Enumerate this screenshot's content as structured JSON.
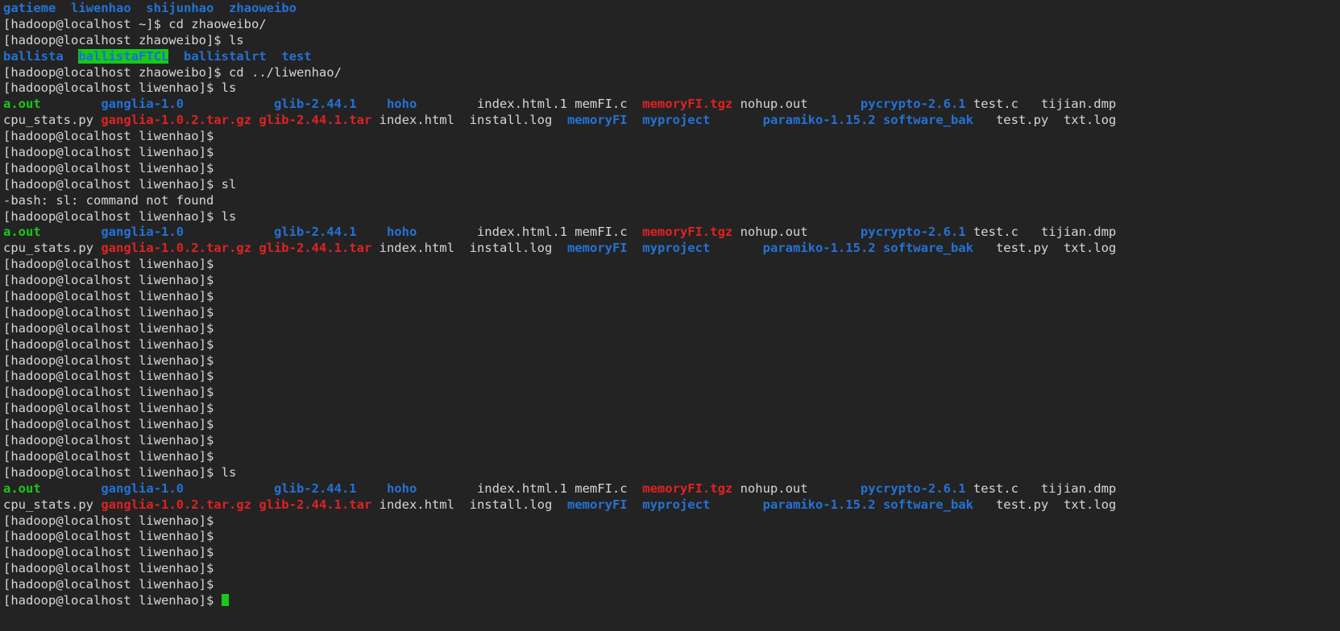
{
  "terminal": {
    "title": "Terminal",
    "background_color": "#232323",
    "foreground_color": "#d6d6d6",
    "dir_color": "#2472d4",
    "exec_color": "#19c819",
    "archive_color": "#e02222",
    "highlight_bg_color": "#19c819",
    "cursor_color": "#19c819",
    "prompt_home": "[hadoop@localhost ~]$ ",
    "prompt_zhaoweibo": "[hadoop@localhost zhaoweibo]$ ",
    "prompt_liwenhao": "[hadoop@localhost liwenhao]$ ",
    "commands": {
      "cd_zhaoweibo": "cd zhaoweibo/",
      "ls": "ls",
      "cd_liwenhao": "cd ../liwenhao/",
      "sl": "sl"
    },
    "errors": {
      "sl_not_found": "-bash: sl: command not found"
    }
  },
  "lines": [
    {
      "name": "home-dir-listing",
      "segments": [
        {
          "text": "gatieme",
          "style": "dir"
        },
        {
          "text": "  ",
          "style": "default"
        },
        {
          "text": "liwenhao",
          "style": "dir"
        },
        {
          "text": "  ",
          "style": "default"
        },
        {
          "text": "shijunhao",
          "style": "dir"
        },
        {
          "text": "  ",
          "style": "default"
        },
        {
          "text": "zhaoweibo",
          "style": "dir"
        }
      ]
    },
    {
      "name": "prompt-cd-zhaoweibo",
      "segments": [
        {
          "text": "[hadoop@localhost ~]$ cd zhaoweibo/",
          "style": "default"
        }
      ]
    },
    {
      "name": "prompt-ls-zhaoweibo",
      "segments": [
        {
          "text": "[hadoop@localhost zhaoweibo]$ ls",
          "style": "default"
        }
      ]
    },
    {
      "name": "zhaoweibo-listing",
      "segments": [
        {
          "text": "ballista",
          "style": "dir"
        },
        {
          "text": "  ",
          "style": "default"
        },
        {
          "text": "ballistaFTCL",
          "style": "hl-dir"
        },
        {
          "text": "  ",
          "style": "default"
        },
        {
          "text": "ballistalrt",
          "style": "dir"
        },
        {
          "text": "  ",
          "style": "default"
        },
        {
          "text": "test",
          "style": "dir"
        }
      ]
    },
    {
      "name": "prompt-cd-liwenhao",
      "segments": [
        {
          "text": "[hadoop@localhost zhaoweibo]$ cd ../liwenhao/",
          "style": "default"
        }
      ]
    },
    {
      "name": "prompt-ls-liwenhao-1",
      "segments": [
        {
          "text": "[hadoop@localhost liwenhao]$ ls",
          "style": "default"
        }
      ]
    },
    {
      "name": "liwenhao-listing-row1-a",
      "segments": [
        {
          "text": "a.out",
          "style": "exec"
        },
        {
          "text": "        ",
          "style": "default"
        },
        {
          "text": "ganglia-1.0",
          "style": "dir"
        },
        {
          "text": "            ",
          "style": "default"
        },
        {
          "text": "glib-2.44.1",
          "style": "dir"
        },
        {
          "text": "    ",
          "style": "default"
        },
        {
          "text": "hoho",
          "style": "dir"
        },
        {
          "text": "        ",
          "style": "default"
        },
        {
          "text": "index.html.1",
          "style": "default"
        },
        {
          "text": " ",
          "style": "default"
        },
        {
          "text": "memFI.c",
          "style": "default"
        },
        {
          "text": "  ",
          "style": "default"
        },
        {
          "text": "memoryFI.tgz",
          "style": "arch"
        },
        {
          "text": " ",
          "style": "default"
        },
        {
          "text": "nohup.out",
          "style": "default"
        },
        {
          "text": "       ",
          "style": "default"
        },
        {
          "text": "pycrypto-2.6.1",
          "style": "dir"
        },
        {
          "text": " ",
          "style": "default"
        },
        {
          "text": "test.c",
          "style": "default"
        },
        {
          "text": "   ",
          "style": "default"
        },
        {
          "text": "tijian.dmp",
          "style": "default"
        }
      ]
    },
    {
      "name": "liwenhao-listing-row1-b",
      "segments": [
        {
          "text": "cpu_stats.py",
          "style": "default"
        },
        {
          "text": " ",
          "style": "default"
        },
        {
          "text": "ganglia-1.0.2.tar.gz",
          "style": "arch"
        },
        {
          "text": " ",
          "style": "default"
        },
        {
          "text": "glib-2.44.1.tar",
          "style": "arch"
        },
        {
          "text": " ",
          "style": "default"
        },
        {
          "text": "index.html",
          "style": "default"
        },
        {
          "text": "  ",
          "style": "default"
        },
        {
          "text": "install.log",
          "style": "default"
        },
        {
          "text": "  ",
          "style": "default"
        },
        {
          "text": "memoryFI",
          "style": "dir"
        },
        {
          "text": "  ",
          "style": "default"
        },
        {
          "text": "myproject",
          "style": "dir"
        },
        {
          "text": "       ",
          "style": "default"
        },
        {
          "text": "paramiko-1.15.2",
          "style": "dir"
        },
        {
          "text": " ",
          "style": "default"
        },
        {
          "text": "software_bak",
          "style": "dir"
        },
        {
          "text": "   ",
          "style": "default"
        },
        {
          "text": "test.py",
          "style": "default"
        },
        {
          "text": "  ",
          "style": "default"
        },
        {
          "text": "txt.log",
          "style": "default"
        }
      ]
    },
    {
      "name": "prompt-blank-1",
      "segments": [
        {
          "text": "[hadoop@localhost liwenhao]$ ",
          "style": "default"
        }
      ]
    },
    {
      "name": "prompt-blank-2",
      "segments": [
        {
          "text": "[hadoop@localhost liwenhao]$ ",
          "style": "default"
        }
      ]
    },
    {
      "name": "prompt-blank-3",
      "segments": [
        {
          "text": "[hadoop@localhost liwenhao]$ ",
          "style": "default"
        }
      ]
    },
    {
      "name": "prompt-sl",
      "segments": [
        {
          "text": "[hadoop@localhost liwenhao]$ sl",
          "style": "default"
        }
      ]
    },
    {
      "name": "error-sl-not-found",
      "segments": [
        {
          "text": "-bash: sl: command not found",
          "style": "default"
        }
      ]
    },
    {
      "name": "prompt-ls-liwenhao-2",
      "segments": [
        {
          "text": "[hadoop@localhost liwenhao]$ ls",
          "style": "default"
        }
      ]
    },
    {
      "name": "liwenhao-listing2-row1-a",
      "segments": [
        {
          "text": "a.out",
          "style": "exec"
        },
        {
          "text": "        ",
          "style": "default"
        },
        {
          "text": "ganglia-1.0",
          "style": "dir"
        },
        {
          "text": "            ",
          "style": "default"
        },
        {
          "text": "glib-2.44.1",
          "style": "dir"
        },
        {
          "text": "    ",
          "style": "default"
        },
        {
          "text": "hoho",
          "style": "dir"
        },
        {
          "text": "        ",
          "style": "default"
        },
        {
          "text": "index.html.1",
          "style": "default"
        },
        {
          "text": " ",
          "style": "default"
        },
        {
          "text": "memFI.c",
          "style": "default"
        },
        {
          "text": "  ",
          "style": "default"
        },
        {
          "text": "memoryFI.tgz",
          "style": "arch"
        },
        {
          "text": " ",
          "style": "default"
        },
        {
          "text": "nohup.out",
          "style": "default"
        },
        {
          "text": "       ",
          "style": "default"
        },
        {
          "text": "pycrypto-2.6.1",
          "style": "dir"
        },
        {
          "text": " ",
          "style": "default"
        },
        {
          "text": "test.c",
          "style": "default"
        },
        {
          "text": "   ",
          "style": "default"
        },
        {
          "text": "tijian.dmp",
          "style": "default"
        }
      ]
    },
    {
      "name": "liwenhao-listing2-row1-b",
      "segments": [
        {
          "text": "cpu_stats.py",
          "style": "default"
        },
        {
          "text": " ",
          "style": "default"
        },
        {
          "text": "ganglia-1.0.2.tar.gz",
          "style": "arch"
        },
        {
          "text": " ",
          "style": "default"
        },
        {
          "text": "glib-2.44.1.tar",
          "style": "arch"
        },
        {
          "text": " ",
          "style": "default"
        },
        {
          "text": "index.html",
          "style": "default"
        },
        {
          "text": "  ",
          "style": "default"
        },
        {
          "text": "install.log",
          "style": "default"
        },
        {
          "text": "  ",
          "style": "default"
        },
        {
          "text": "memoryFI",
          "style": "dir"
        },
        {
          "text": "  ",
          "style": "default"
        },
        {
          "text": "myproject",
          "style": "dir"
        },
        {
          "text": "       ",
          "style": "default"
        },
        {
          "text": "paramiko-1.15.2",
          "style": "dir"
        },
        {
          "text": " ",
          "style": "default"
        },
        {
          "text": "software_bak",
          "style": "dir"
        },
        {
          "text": "   ",
          "style": "default"
        },
        {
          "text": "test.py",
          "style": "default"
        },
        {
          "text": "  ",
          "style": "default"
        },
        {
          "text": "txt.log",
          "style": "default"
        }
      ]
    },
    {
      "name": "prompt-blank-4",
      "segments": [
        {
          "text": "[hadoop@localhost liwenhao]$ ",
          "style": "default"
        }
      ]
    },
    {
      "name": "prompt-blank-5",
      "segments": [
        {
          "text": "[hadoop@localhost liwenhao]$ ",
          "style": "default"
        }
      ]
    },
    {
      "name": "prompt-blank-6",
      "segments": [
        {
          "text": "[hadoop@localhost liwenhao]$ ",
          "style": "default"
        }
      ]
    },
    {
      "name": "prompt-blank-7",
      "segments": [
        {
          "text": "[hadoop@localhost liwenhao]$ ",
          "style": "default"
        }
      ]
    },
    {
      "name": "prompt-blank-8",
      "segments": [
        {
          "text": "[hadoop@localhost liwenhao]$ ",
          "style": "default"
        }
      ]
    },
    {
      "name": "prompt-blank-9",
      "segments": [
        {
          "text": "[hadoop@localhost liwenhao]$ ",
          "style": "default"
        }
      ]
    },
    {
      "name": "prompt-blank-10",
      "segments": [
        {
          "text": "[hadoop@localhost liwenhao]$ ",
          "style": "default"
        }
      ]
    },
    {
      "name": "prompt-blank-11",
      "segments": [
        {
          "text": "[hadoop@localhost liwenhao]$ ",
          "style": "default"
        }
      ]
    },
    {
      "name": "prompt-blank-12",
      "segments": [
        {
          "text": "[hadoop@localhost liwenhao]$ ",
          "style": "default"
        }
      ]
    },
    {
      "name": "prompt-blank-13",
      "segments": [
        {
          "text": "[hadoop@localhost liwenhao]$ ",
          "style": "default"
        }
      ]
    },
    {
      "name": "prompt-blank-14",
      "segments": [
        {
          "text": "[hadoop@localhost liwenhao]$ ",
          "style": "default"
        }
      ]
    },
    {
      "name": "prompt-blank-15",
      "segments": [
        {
          "text": "[hadoop@localhost liwenhao]$ ",
          "style": "default"
        }
      ]
    },
    {
      "name": "prompt-blank-16",
      "segments": [
        {
          "text": "[hadoop@localhost liwenhao]$ ",
          "style": "default"
        }
      ]
    },
    {
      "name": "prompt-ls-liwenhao-3",
      "segments": [
        {
          "text": "[hadoop@localhost liwenhao]$ ls",
          "style": "default"
        }
      ]
    },
    {
      "name": "liwenhao-listing3-row1-a",
      "segments": [
        {
          "text": "a.out",
          "style": "exec"
        },
        {
          "text": "        ",
          "style": "default"
        },
        {
          "text": "ganglia-1.0",
          "style": "dir"
        },
        {
          "text": "            ",
          "style": "default"
        },
        {
          "text": "glib-2.44.1",
          "style": "dir"
        },
        {
          "text": "    ",
          "style": "default"
        },
        {
          "text": "hoho",
          "style": "dir"
        },
        {
          "text": "        ",
          "style": "default"
        },
        {
          "text": "index.html.1",
          "style": "default"
        },
        {
          "text": " ",
          "style": "default"
        },
        {
          "text": "memFI.c",
          "style": "default"
        },
        {
          "text": "  ",
          "style": "default"
        },
        {
          "text": "memoryFI.tgz",
          "style": "arch"
        },
        {
          "text": " ",
          "style": "default"
        },
        {
          "text": "nohup.out",
          "style": "default"
        },
        {
          "text": "       ",
          "style": "default"
        },
        {
          "text": "pycrypto-2.6.1",
          "style": "dir"
        },
        {
          "text": " ",
          "style": "default"
        },
        {
          "text": "test.c",
          "style": "default"
        },
        {
          "text": "   ",
          "style": "default"
        },
        {
          "text": "tijian.dmp",
          "style": "default"
        }
      ]
    },
    {
      "name": "liwenhao-listing3-row1-b",
      "segments": [
        {
          "text": "cpu_stats.py",
          "style": "default"
        },
        {
          "text": " ",
          "style": "default"
        },
        {
          "text": "ganglia-1.0.2.tar.gz",
          "style": "arch"
        },
        {
          "text": " ",
          "style": "default"
        },
        {
          "text": "glib-2.44.1.tar",
          "style": "arch"
        },
        {
          "text": " ",
          "style": "default"
        },
        {
          "text": "index.html",
          "style": "default"
        },
        {
          "text": "  ",
          "style": "default"
        },
        {
          "text": "install.log",
          "style": "default"
        },
        {
          "text": "  ",
          "style": "default"
        },
        {
          "text": "memoryFI",
          "style": "dir"
        },
        {
          "text": "  ",
          "style": "default"
        },
        {
          "text": "myproject",
          "style": "dir"
        },
        {
          "text": "       ",
          "style": "default"
        },
        {
          "text": "paramiko-1.15.2",
          "style": "dir"
        },
        {
          "text": " ",
          "style": "default"
        },
        {
          "text": "software_bak",
          "style": "dir"
        },
        {
          "text": "   ",
          "style": "default"
        },
        {
          "text": "test.py",
          "style": "default"
        },
        {
          "text": "  ",
          "style": "default"
        },
        {
          "text": "txt.log",
          "style": "default"
        }
      ]
    },
    {
      "name": "prompt-blank-17",
      "segments": [
        {
          "text": "[hadoop@localhost liwenhao]$ ",
          "style": "default"
        }
      ]
    },
    {
      "name": "prompt-blank-18",
      "segments": [
        {
          "text": "[hadoop@localhost liwenhao]$ ",
          "style": "default"
        }
      ]
    },
    {
      "name": "prompt-blank-19",
      "segments": [
        {
          "text": "[hadoop@localhost liwenhao]$ ",
          "style": "default"
        }
      ]
    },
    {
      "name": "prompt-blank-20",
      "segments": [
        {
          "text": "[hadoop@localhost liwenhao]$ ",
          "style": "default"
        }
      ]
    },
    {
      "name": "prompt-blank-21",
      "segments": [
        {
          "text": "[hadoop@localhost liwenhao]$ ",
          "style": "default"
        }
      ]
    },
    {
      "name": "prompt-active-cursor",
      "cursor": true,
      "segments": [
        {
          "text": "[hadoop@localhost liwenhao]$ ",
          "style": "default"
        }
      ]
    }
  ]
}
